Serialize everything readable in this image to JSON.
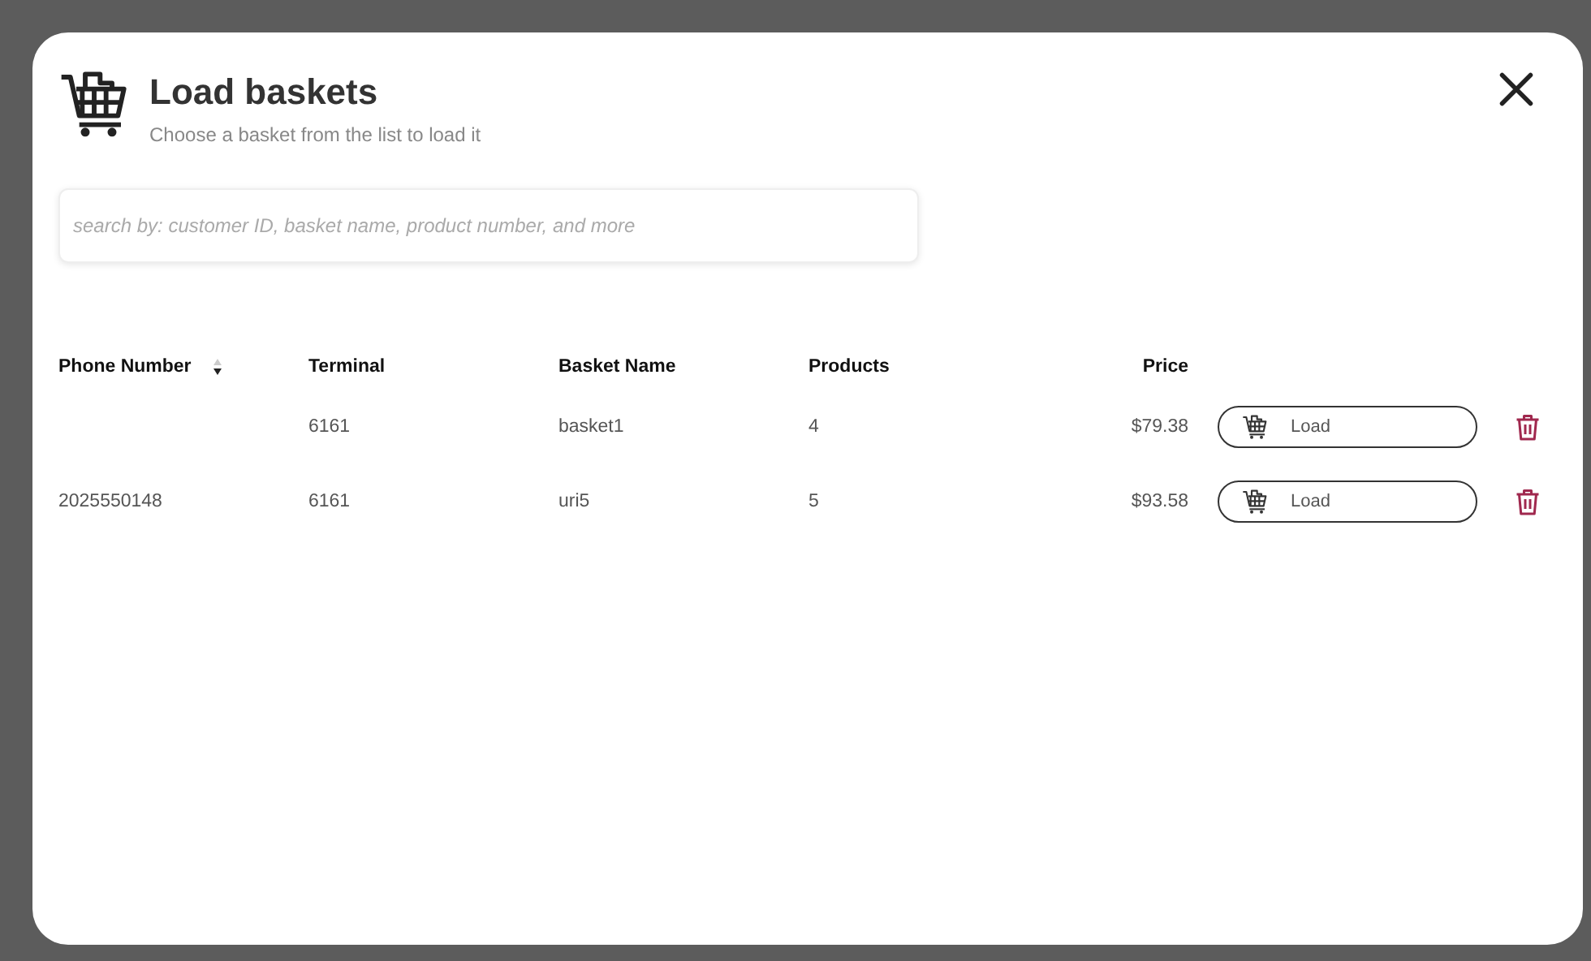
{
  "dialog": {
    "title": "Load baskets",
    "subtitle": "Choose a basket from the list to load it"
  },
  "search": {
    "placeholder": "search by: customer ID, basket name, product number, and more"
  },
  "table": {
    "columns": [
      {
        "label": "Phone Number",
        "sorted_descending": true
      },
      {
        "label": "Terminal",
        "sorted_descending": false
      },
      {
        "label": "Basket Name",
        "sorted_descending": false
      },
      {
        "label": "Products",
        "sorted_descending": false
      },
      {
        "label": "Price",
        "sorted_descending": false
      }
    ],
    "rows": [
      {
        "cells": [
          "",
          "6161",
          "basket1",
          "4",
          "$79.38"
        ],
        "action": "Load"
      },
      {
        "cells": [
          "2025550148",
          "6161",
          "uri5",
          "5",
          "$93.58"
        ],
        "action": "Load"
      }
    ]
  }
}
